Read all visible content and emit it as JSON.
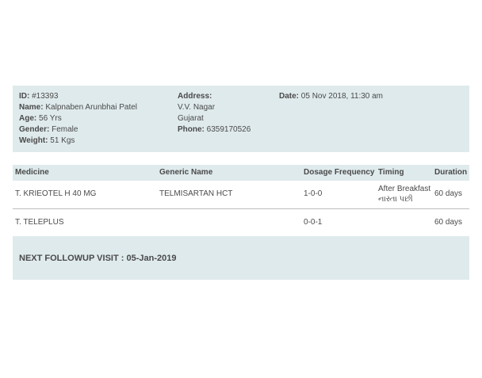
{
  "patient": {
    "id_label": "ID:",
    "id_value": "#13393",
    "name_label": "Name:",
    "name_value": "Kalpnaben Arunbhai Patel",
    "age_label": "Age:",
    "age_value": "56 Yrs",
    "gender_label": "Gender:",
    "gender_value": "Female",
    "weight_label": "Weight:",
    "weight_value": "51 Kgs",
    "address_label": "Address:",
    "address_lines": [
      "V.V. Nagar",
      "Gujarat"
    ],
    "phone_label": "Phone:",
    "phone_value": "6359170526",
    "date_label": "Date:",
    "date_value": "05 Nov 2018, 11:30 am"
  },
  "prescription": {
    "headers": [
      "Medicine",
      "Generic Name",
      "Dosage Frequency",
      "Timing",
      "Duration"
    ],
    "rows": [
      {
        "medicine": "T. KRIEOTEL H 40 MG",
        "generic": "TELMISARTAN HCT",
        "dosage": "1-0-0",
        "timing": [
          "After Breakfast",
          "નાસ્તા પછી"
        ],
        "duration": "60 days"
      },
      {
        "medicine": "T. TELEPLUS",
        "generic": "",
        "dosage": "0-0-1",
        "timing": [],
        "duration": "60 days"
      }
    ]
  },
  "followup": {
    "text": "NEXT FOLLOWUP VISIT : 05-Jan-2019"
  },
  "colors": {
    "panel_background": "#dfeaec",
    "text": "#4a4a4a",
    "row_divider": "#bdbdbd"
  }
}
